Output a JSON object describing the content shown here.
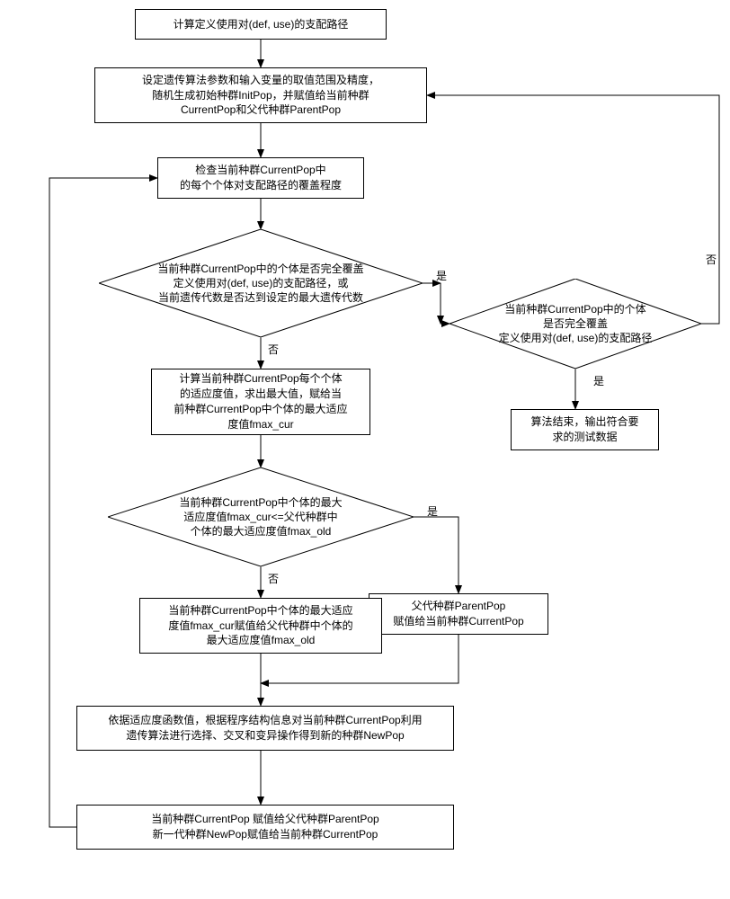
{
  "nodes": {
    "n1": "计算定义使用对(def, use)的支配路径",
    "n2": "设定遗传算法参数和输入变量的取值范围及精度，\n随机生成初始种群InitPop，并赋值给当前种群\nCurrentPop和父代种群ParentPop",
    "n3": "检查当前种群CurrentPop中\n的每个个体对支配路径的覆盖程度",
    "d1": "当前种群CurrentPop中的个体是否完全覆盖\n定义使用对(def, use)的支配路径，或\n当前遗传代数是否达到设定的最大遗传代数",
    "d2": "当前种群CurrentPop中的个体\n是否完全覆盖\n定义使用对(def, use)的支配路径",
    "n4": "计算当前种群CurrentPop每个个体\n的适应度值，求出最大值，赋给当\n前种群CurrentPop中个体的最大适应\n度值fmax_cur",
    "n5": "算法结束，输出符合要\n求的测试数据",
    "d3": "当前种群CurrentPop中个体的最大\n适应度值fmax_cur<=父代种群中\n个体的最大适应度值fmax_old",
    "n6": "父代种群ParentPop\n赋值给当前种群CurrentPop",
    "n7": "当前种群CurrentPop中个体的最大适应\n度值fmax_cur赋值给父代种群中个体的\n最大适应度值fmax_old",
    "n8": "依据适应度函数值，根据程序结构信息对当前种群CurrentPop利用\n遗传算法进行选择、交叉和变异操作得到新的种群NewPop",
    "n9": "当前种群CurrentPop 赋值给父代种群ParentPop\n新一代种群NewPop赋值给当前种群CurrentPop"
  },
  "labels": {
    "yes": "是",
    "no": "否"
  }
}
